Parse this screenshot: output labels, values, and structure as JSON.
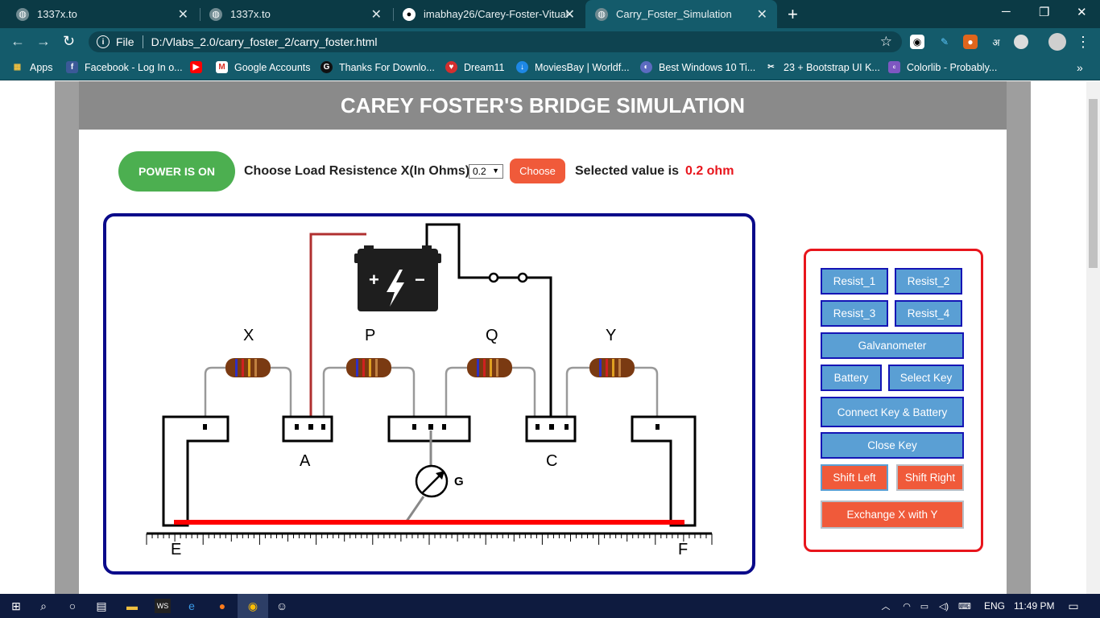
{
  "browser": {
    "tabs": [
      {
        "title": "1337x.to",
        "active": false
      },
      {
        "title": "1337x.to",
        "active": false
      },
      {
        "title": "imabhay26/Carey-Foster-Vitual-L",
        "active": false
      },
      {
        "title": "Carry_Foster_Simulation",
        "active": true
      }
    ],
    "address_scheme": "File",
    "address_url": "D:/Vlabs_2.0/carry_foster_2/carry_foster.html",
    "bookmarks": [
      {
        "label": "Apps",
        "icon": "apps-grid-icon",
        "color": "#f0c040"
      },
      {
        "label": "Facebook - Log In o...",
        "icon": "facebook-icon",
        "color": "#3b5998"
      },
      {
        "label": "",
        "icon": "youtube-icon",
        "color": "#ff0000"
      },
      {
        "label": "Google Accounts",
        "icon": "gmail-icon",
        "color": "#ffffff"
      },
      {
        "label": "Thanks For Downlo...",
        "icon": "g-logo-icon",
        "color": "#111111"
      },
      {
        "label": "Dream11",
        "icon": "dream11-icon",
        "color": "#d32f2f"
      },
      {
        "label": "MoviesBay | Worldf...",
        "icon": "moviesbay-icon",
        "color": "#1e88e5"
      },
      {
        "label": "Best Windows 10 Ti...",
        "icon": "windows-tips-icon",
        "color": "#5c6bc0"
      },
      {
        "label": "23 + Bootstrap UI K...",
        "icon": "bootstrap-icon",
        "color": "#222222"
      },
      {
        "label": "Colorlib - Probably...",
        "icon": "colorlib-icon",
        "color": "#7e57c2"
      }
    ]
  },
  "page": {
    "title": "CAREY FOSTER'S BRIDGE SIMULATION",
    "power_label": "POWER IS ON",
    "choose_label": "Choose Load Resistence X(In Ohms)",
    "select_value": "0.2",
    "choose_button": "Choose",
    "selected_label": "Selected value is",
    "selected_value": "0.2 ohm",
    "colors": {
      "power": "#4caf50",
      "accent": "#f05a3a",
      "button_blue": "#5a9fd4",
      "value_red": "#e8151c"
    }
  },
  "circuit": {
    "resistor_labels": [
      "X",
      "P",
      "Q",
      "Y"
    ],
    "node_labels": {
      "a": "A",
      "c": "C",
      "e": "E",
      "f": "F",
      "g": "G"
    },
    "battery_symbols": {
      "plus": "+",
      "minus": "−"
    }
  },
  "controls": {
    "resist_1": "Resist_1",
    "resist_2": "Resist_2",
    "resist_3": "Resist_3",
    "resist_4": "Resist_4",
    "galvanometer": "Galvanometer",
    "battery": "Battery",
    "select_key": "Select Key",
    "connect_key_battery": "Connect Key & Battery",
    "close_key": "Close Key",
    "shift_left": "Shift Left",
    "shift_right": "Shift Right",
    "exchange": "Exchange X with Y"
  },
  "taskbar": {
    "language": "ENG",
    "time": "11:49 PM"
  }
}
